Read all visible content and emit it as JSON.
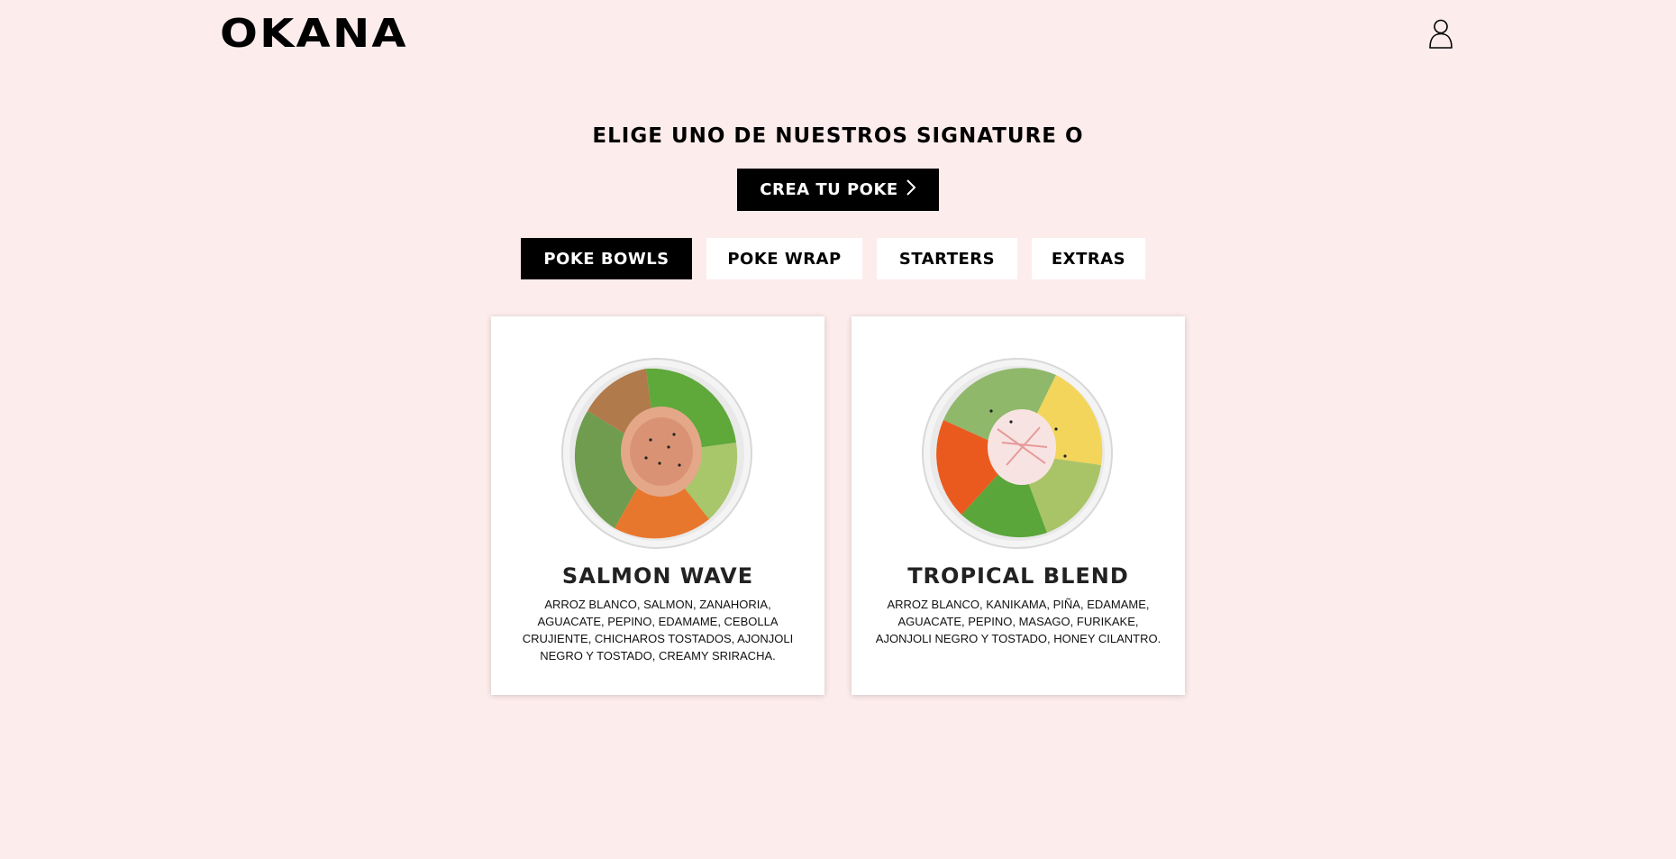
{
  "brand": {
    "logo_text": "OKANA"
  },
  "header": {
    "user_icon": "user-icon"
  },
  "hero": {
    "headline": "ELIGE UNO DE NUESTROS SIGNATURE O",
    "cta_label": "CREA TU POKE",
    "cta_icon": "chevron-right-icon"
  },
  "tabs": [
    {
      "label": "POKE BOWLS",
      "active": true
    },
    {
      "label": "POKE WRAP",
      "active": false
    },
    {
      "label": "STARTERS",
      "active": false
    },
    {
      "label": "EXTRAS",
      "active": false
    }
  ],
  "products": [
    {
      "name": "SALMON WAVE",
      "description": "ARROZ BLANCO, SALMON, ZANAHORIA, AGUACATE, PEPINO, EDAMAME, CEBOLLA CRUJIENTE, CHICHAROS TOSTADOS, AJONJOLI NEGRO Y TOSTADO, CREAMY SRIRACHA."
    },
    {
      "name": "TROPICAL BLEND",
      "description": "ARROZ BLANCO, KANIKAMA, PIÑA, EDAMAME, AGUACATE, PEPINO, MASAGO, FURIKAKE, AJONJOLI NEGRO Y TOSTADO, HONEY CILANTRO."
    }
  ],
  "colors": {
    "page_background": "#fdecec",
    "primary": "#000000",
    "card_background": "#ffffff"
  }
}
